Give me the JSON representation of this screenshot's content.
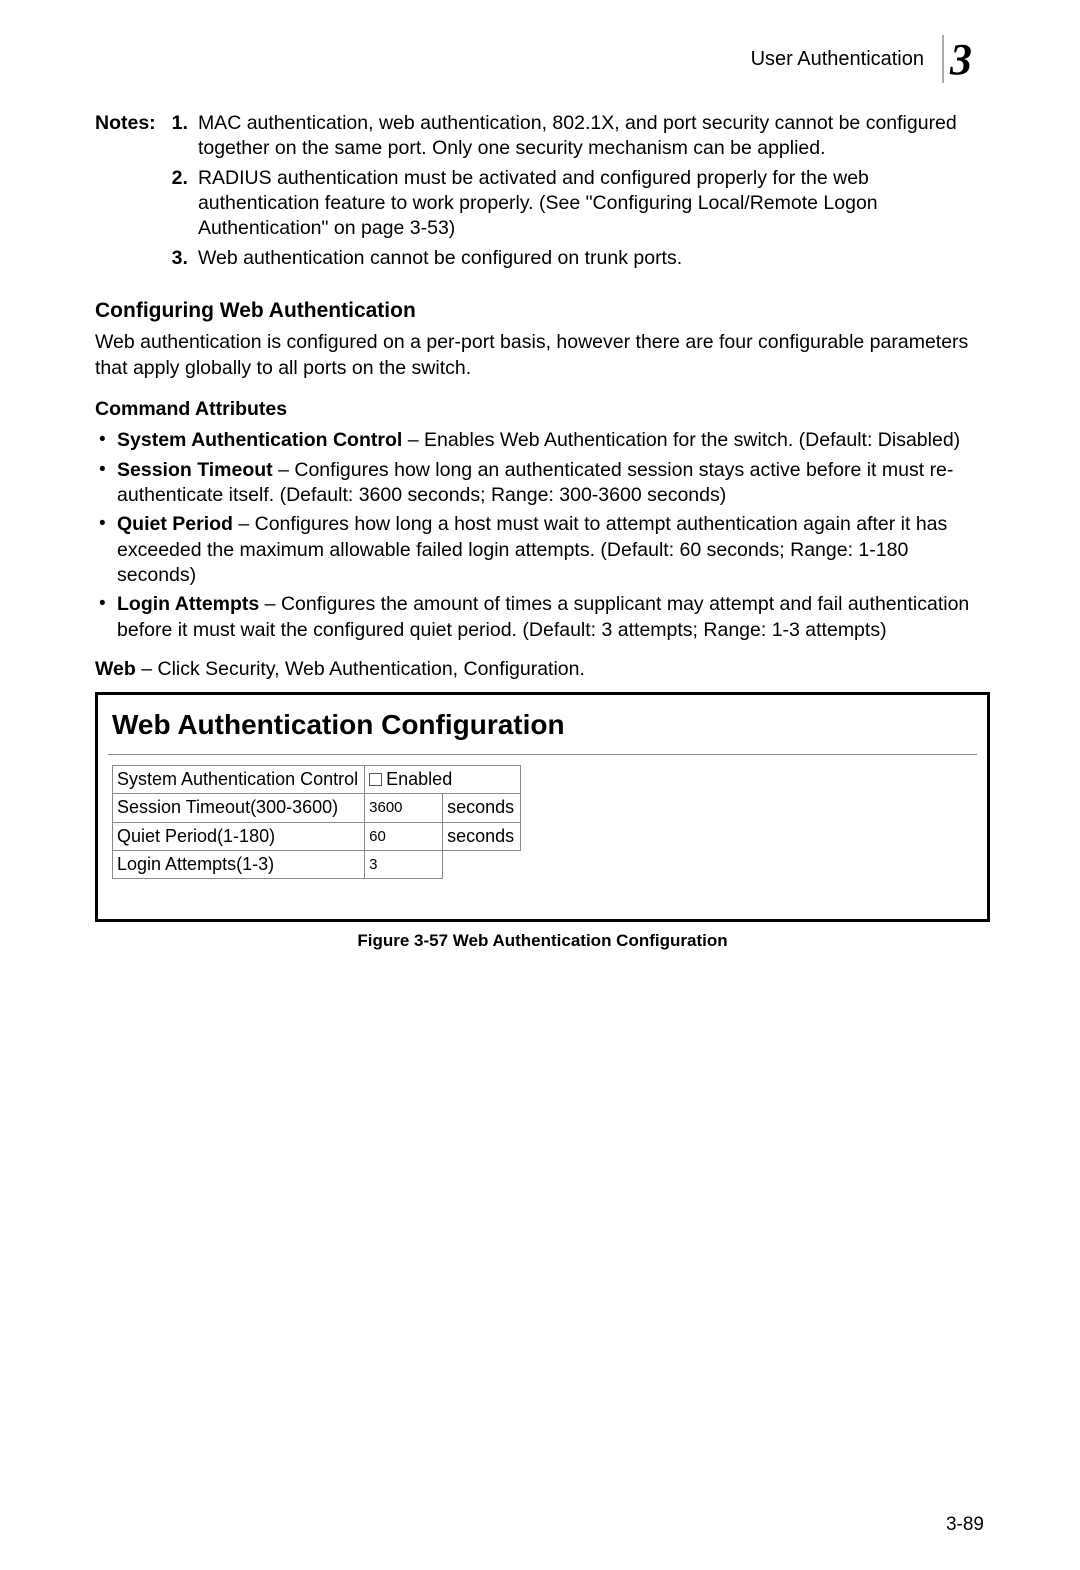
{
  "header": {
    "title": "User Authentication",
    "chapter": "3"
  },
  "notes": {
    "label": "Notes:",
    "items": [
      {
        "num": "1.",
        "text": "MAC authentication, web authentication, 802.1X, and port security cannot be configured together on the same port. Only one security mechanism can be applied."
      },
      {
        "num": "2.",
        "text": "RADIUS authentication must be activated and configured properly for the web authentication feature to work properly. (See \"Configuring Local/Remote Logon Authentication\" on page 3-53)"
      },
      {
        "num": "3.",
        "text": "Web authentication cannot be configured on trunk ports."
      }
    ]
  },
  "section": {
    "heading": "Configuring Web Authentication",
    "intro": "Web authentication is configured on a per-port basis, however there are four configurable parameters that apply globally to all ports on the switch."
  },
  "attrs": {
    "heading": "Command Attributes",
    "items": [
      {
        "term": "System Authentication Control",
        "sep": " – ",
        "text": "Enables Web Authentication for the switch. (Default: Disabled)"
      },
      {
        "term": "Session Timeout",
        "sep": " – ",
        "text": "Configures how long an authenticated session stays active before it must re-authenticate itself. (Default: 3600 seconds; Range: 300-3600 seconds)"
      },
      {
        "term": "Quiet Period",
        "sep": " – ",
        "text": "Configures how long a host must wait to attempt authentication again after it has exceeded the maximum allowable failed login attempts. (Default: 60 seconds; Range: 1-180 seconds)"
      },
      {
        "term": "Login Attempts",
        "sep": " – ",
        "text": "Configures the amount of times a supplicant may attempt and fail authentication before it must wait the configured quiet period. (Default: 3 attempts; Range: 1-3 attempts)"
      }
    ]
  },
  "webpath": {
    "lead": "Web",
    "sep": " – ",
    "text": "Click Security, Web Authentication, Configuration."
  },
  "figure": {
    "title": "Web Authentication Configuration",
    "rows": {
      "r0": {
        "label": "System Authentication Control",
        "enabled_label": "Enabled"
      },
      "r1": {
        "label": "Session Timeout(300-3600)",
        "value": "3600",
        "unit": "seconds"
      },
      "r2": {
        "label": "Quiet Period(1-180)",
        "value": "60",
        "unit": "seconds"
      },
      "r3": {
        "label": "Login Attempts(1-3)",
        "value": "3"
      }
    },
    "caption": "Figure 3-57  Web Authentication Configuration"
  },
  "page_num": "3-89"
}
